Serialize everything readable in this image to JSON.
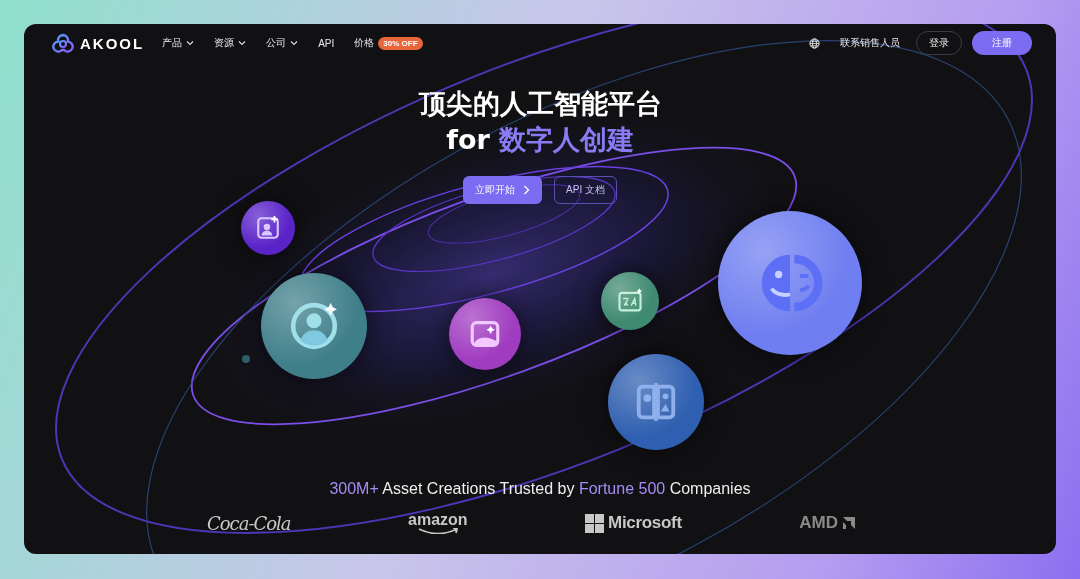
{
  "nav": {
    "logo": "AKOOL",
    "items": [
      {
        "label": "产品",
        "dropdown": true
      },
      {
        "label": "资源",
        "dropdown": true
      },
      {
        "label": "公司",
        "dropdown": true
      },
      {
        "label": "API",
        "dropdown": false
      },
      {
        "label": "价格",
        "dropdown": false,
        "badge": "30% OFF"
      }
    ],
    "contact": "联系销售人员",
    "login": "登录",
    "signup": "注册"
  },
  "hero": {
    "title": "顶尖的人工智能平台",
    "subtitle_prefix": "for",
    "subtitle_highlight": "数字人创建",
    "primary_button": "立即开始",
    "secondary_button": "API 文档"
  },
  "features": [
    {
      "kind": "portrait",
      "color": "#5a23c8"
    },
    {
      "kind": "avatar",
      "color": "#3f7f8a"
    },
    {
      "kind": "image",
      "color": "#a03cc0"
    },
    {
      "kind": "translate",
      "color": "#3f8a70"
    },
    {
      "kind": "face",
      "color": "#6f7ef0"
    },
    {
      "kind": "swap",
      "color": "#2f5fb0"
    }
  ],
  "trust": [
    {
      "text": "300M+",
      "highlight": true
    },
    {
      "text": "Asset Creations Trusted by",
      "highlight": false
    },
    {
      "text": "Fortune 500",
      "highlight": true
    },
    {
      "text": "Companies",
      "highlight": false
    }
  ],
  "brands": [
    {
      "kind": "coca-cola",
      "name": "Coca-Cola"
    },
    {
      "kind": "amazon",
      "name": "amazon"
    },
    {
      "kind": "microsoft",
      "name": "Microsoft"
    },
    {
      "kind": "amd",
      "name": "AMD"
    }
  ]
}
